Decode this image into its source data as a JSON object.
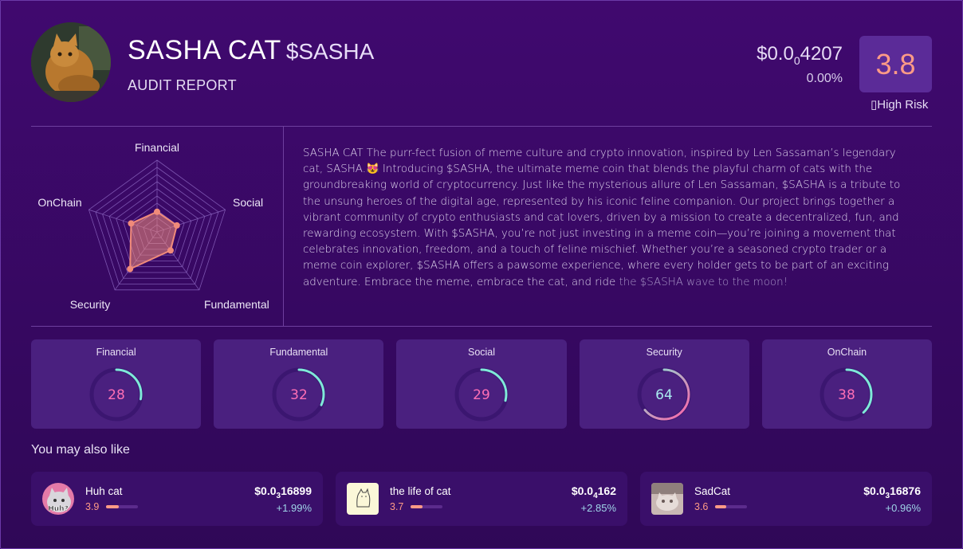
{
  "header": {
    "name": "SASHA CAT",
    "ticker": "$SASHA",
    "subtitle": "AUDIT REPORT",
    "price_prefix": "$0.0",
    "price_zeros": "0",
    "price_digits": "4207",
    "change": "0.00%",
    "score": "3.8",
    "risk_label": "▯High Risk"
  },
  "radar": {
    "axes": [
      "Financial",
      "Social",
      "Fundamental",
      "Security",
      "OnChain"
    ],
    "values": [
      28,
      29,
      32,
      64,
      38
    ],
    "max": 100,
    "fill_color": "#f08a7a"
  },
  "description": {
    "main": "SASHA CAT The purr-fect fusion of meme culture and crypto innovation, inspired by Len Sassaman’s legendary cat, SASHA.😻 Introducing $SASHA, the ultimate meme coin that blends the playful charm of cats with the groundbreaking world of cryptocurrency. Just like the mysterious allure of Len Sassaman, $SASHA is a tribute to the unsung heroes of the digital age, represented by his iconic feline companion. Our project brings together a vibrant community of crypto enthusiasts and cat lovers, driven by a mission to create a decentralized, fun, and rewarding ecosystem. With $SASHA, you’re not just investing in a meme coin—you’re joining a movement that celebrates innovation, freedom, and a touch of feline mischief. Whether you’re a seasoned crypto trader or a meme coin explorer, $SASHA offers a pawsome experience, where every holder gets to be part of an exciting adventure. Embrace the meme, embrace the cat, and ride",
    "faded": "the $SASHA wave to the moon!"
  },
  "score_cards": [
    {
      "label": "Financial",
      "value": "28",
      "pct": 28
    },
    {
      "label": "Fundamental",
      "value": "32",
      "pct": 32
    },
    {
      "label": "Social",
      "value": "29",
      "pct": 29
    },
    {
      "label": "Security",
      "value": "64",
      "pct": 64
    },
    {
      "label": "OnChain",
      "value": "38",
      "pct": 38
    }
  ],
  "recommendations": {
    "title": "You may also like",
    "items": [
      {
        "name": "Huh cat",
        "score": "3.9",
        "score_fraction": 0.39,
        "price_prefix": "$0.0",
        "price_zeros": "3",
        "price_digits": "16899",
        "change": "+1.99%",
        "icon_text": "Huh?"
      },
      {
        "name": "the life of cat",
        "score": "3.7",
        "score_fraction": 0.37,
        "price_prefix": "$0.0",
        "price_zeros": "4",
        "price_digits": "162",
        "change": "+2.85%"
      },
      {
        "name": "SadCat",
        "score": "3.6",
        "score_fraction": 0.36,
        "price_prefix": "$0.0",
        "price_zeros": "3",
        "price_digits": "16876",
        "change": "+0.96%"
      }
    ]
  },
  "colors": {
    "background": "#3a0a66",
    "card": "#4a207f",
    "accent_score": "#ff9b86",
    "ring_low": "#ff5fa8",
    "ring_high": "#7fe9d8"
  }
}
